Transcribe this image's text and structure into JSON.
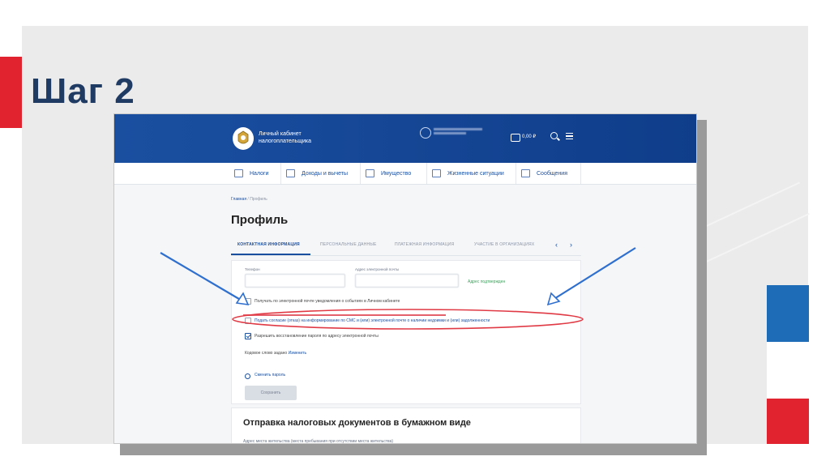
{
  "slide": {
    "title": "Шаг 2"
  },
  "header": {
    "brand_line1": "Личный кабинет",
    "brand_line2": "налогоплательщика",
    "user_name_line1": "",
    "user_name_line2": "",
    "balance": "0,00 ₽"
  },
  "nav": {
    "items": [
      {
        "label": "Налоги",
        "icon": "taxes-icon"
      },
      {
        "label": "Доходы и вычеты",
        "icon": "income-icon"
      },
      {
        "label": "Имущество",
        "icon": "property-icon"
      },
      {
        "label": "Жизненные ситуации",
        "icon": "life-situations-icon"
      },
      {
        "label": "Сообщения",
        "icon": "messages-icon"
      }
    ]
  },
  "breadcrumb": {
    "home": "Главная",
    "sep": " / ",
    "current": "Профиль"
  },
  "page": {
    "title": "Профиль"
  },
  "tabs": [
    {
      "label": "КОНТАКТНАЯ ИНФОРМАЦИЯ",
      "active": true
    },
    {
      "label": "ПЕРСОНАЛЬНЫЕ ДАННЫЕ",
      "active": false
    },
    {
      "label": "ПЛАТЕЖНАЯ ИНФОРМАЦИЯ",
      "active": false
    },
    {
      "label": "УЧАСТИЕ В ОРГАНИЗАЦИЯХ",
      "active": false
    }
  ],
  "contact": {
    "phone_label": "Телефон",
    "phone_value": "",
    "email_label": "Адрес электронной почты",
    "email_value": "",
    "email_status": "Адрес подтвержден",
    "notify_label": "Получать по электронной почте уведомления о событиях в Личном кабинете",
    "consent_label": "Подать согласие (отказ) на информирование по СМС и (или) электронной почте о наличии недоимки и (или) задолженности",
    "restore_label": "Разрешить восстановление пароля по адресу электронной почты",
    "codeword_label": "Кодовое слово задано",
    "codeword_action": "Изменить",
    "change_password": "Сменить пароль",
    "save_button": "Сохранить"
  },
  "paper_docs": {
    "title": "Отправка налоговых документов в бумажном виде",
    "subtitle": "Адрес места жительства (места пребывания при отсутствии места жительства)"
  },
  "colors": {
    "header_blue": "#1a4fa0",
    "accent_red": "#e0232e",
    "annotation_blue": "#2f6fce",
    "highlight_red": "#e03a45"
  }
}
